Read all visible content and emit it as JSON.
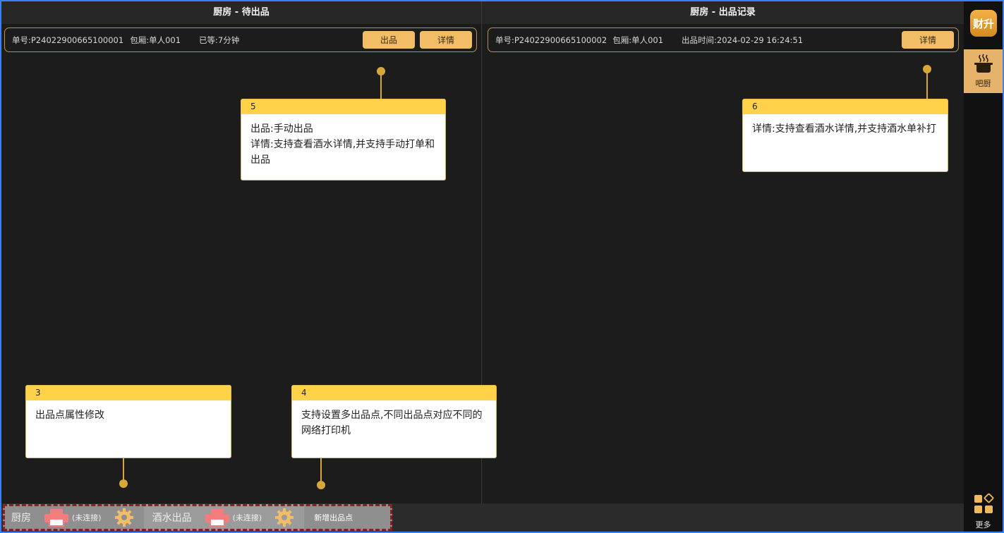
{
  "left_panel": {
    "title": "厨房 - 待出品",
    "order": {
      "order_no": "单号:P24022900665100001",
      "room": "包厢:单人001",
      "wait": "已等:7分钟",
      "out_label": "出品",
      "detail_label": "详情"
    }
  },
  "right_panel": {
    "title": "厨房 - 出品记录",
    "order": {
      "order_no": "单号:P24022900665100002",
      "room": "包厢:单人001",
      "out_time": "出品时间:2024-02-29 16:24:51",
      "detail_label": "详情"
    }
  },
  "sidebar": {
    "logo_text": "财升",
    "active_item": "吧厨",
    "more": "更多",
    "accent": "#e7b269"
  },
  "bottom_bar": {
    "stations": [
      {
        "name": "厨房",
        "status": "(未连接)"
      },
      {
        "name": "酒水出品",
        "status": "(未连接)"
      }
    ],
    "add_label": "新增出品点"
  },
  "tooltips": [
    {
      "num": "5",
      "lines": [
        "出品:手动出品",
        "详情:支持查看酒水详情,并支持手动打单和出品"
      ]
    },
    {
      "num": "6",
      "lines": [
        "详情:支持查看酒水详情,并支持酒水单补打"
      ]
    },
    {
      "num": "3",
      "lines": [
        "出品点属性修改"
      ]
    },
    {
      "num": "4",
      "lines": [
        "支持设置多出品点,不同出品点对应不同的网络打印机"
      ]
    }
  ],
  "colors": {
    "button": "#f2bd67",
    "tooltip_header": "#ffd24a",
    "connector": "#d8a73a",
    "background": "#1c1c1c"
  }
}
